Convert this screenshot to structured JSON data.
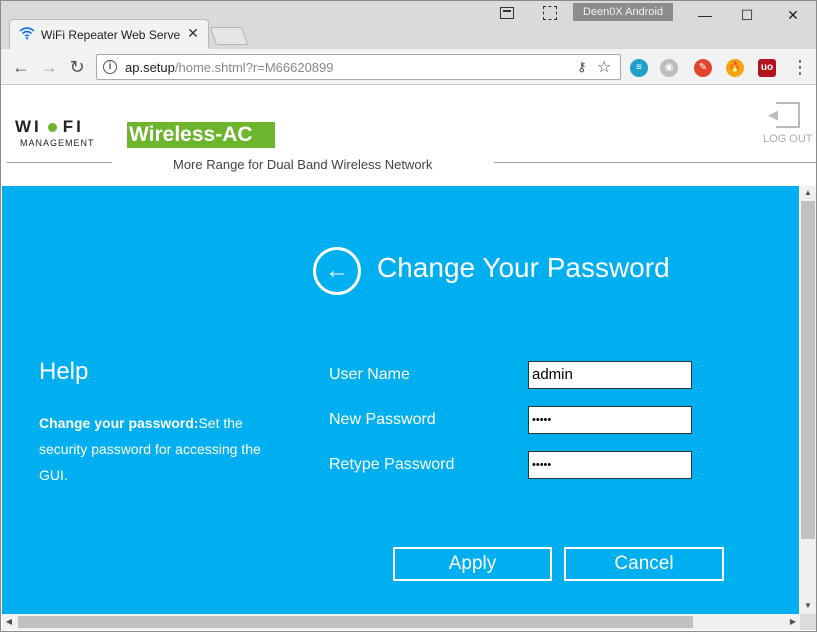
{
  "browser": {
    "tab_title": "WiFi Repeater Web Serve",
    "tab_close": "✕",
    "profile_name": "Deen0X Android",
    "window_controls": {
      "minimize": "—",
      "maximize": "☐",
      "close": "✕"
    },
    "nav": {
      "back": "←",
      "forward": "→",
      "reload": "↻"
    },
    "url_host": "ap.setup",
    "url_path": "/home.shtml?r=M66620899",
    "menu": "⋮",
    "extensions": [
      {
        "name": "extension-1",
        "label": "≡",
        "color": "#1da1c9"
      },
      {
        "name": "extension-2",
        "label": "◉",
        "color": "#bdbdbd"
      },
      {
        "name": "extension-3",
        "label": "✎",
        "color": "#e0452e"
      },
      {
        "name": "extension-4",
        "label": "🔥",
        "color": "#f4a516"
      },
      {
        "name": "extension-5",
        "label": "uo",
        "color": "#b3131b"
      }
    ]
  },
  "header": {
    "logo_left": "WI",
    "logo_right": "FI",
    "logo_sub": "MANAGEMENT",
    "brand": "Wireless-AC",
    "tagline": "More Range for Dual Band Wireless Network",
    "logout_label": "LOG OUT",
    "accent_color": "#6cb52d"
  },
  "panel": {
    "background": "#00aff0",
    "title": "Change Your Password",
    "back_glyph": "←"
  },
  "help": {
    "title": "Help",
    "strong": "Change your password:",
    "text": "Set the security password for accessing the GUI."
  },
  "form": {
    "fields": [
      {
        "label": "User Name",
        "value": "admin",
        "type": "text"
      },
      {
        "label": "New Password",
        "value": "•••••",
        "type": "password"
      },
      {
        "label": "Retype Password",
        "value": "•••••",
        "type": "password"
      }
    ],
    "apply_label": "Apply",
    "cancel_label": "Cancel"
  },
  "scroll": {
    "up": "▲",
    "down": "▼",
    "left": "◀",
    "right": "▶"
  }
}
